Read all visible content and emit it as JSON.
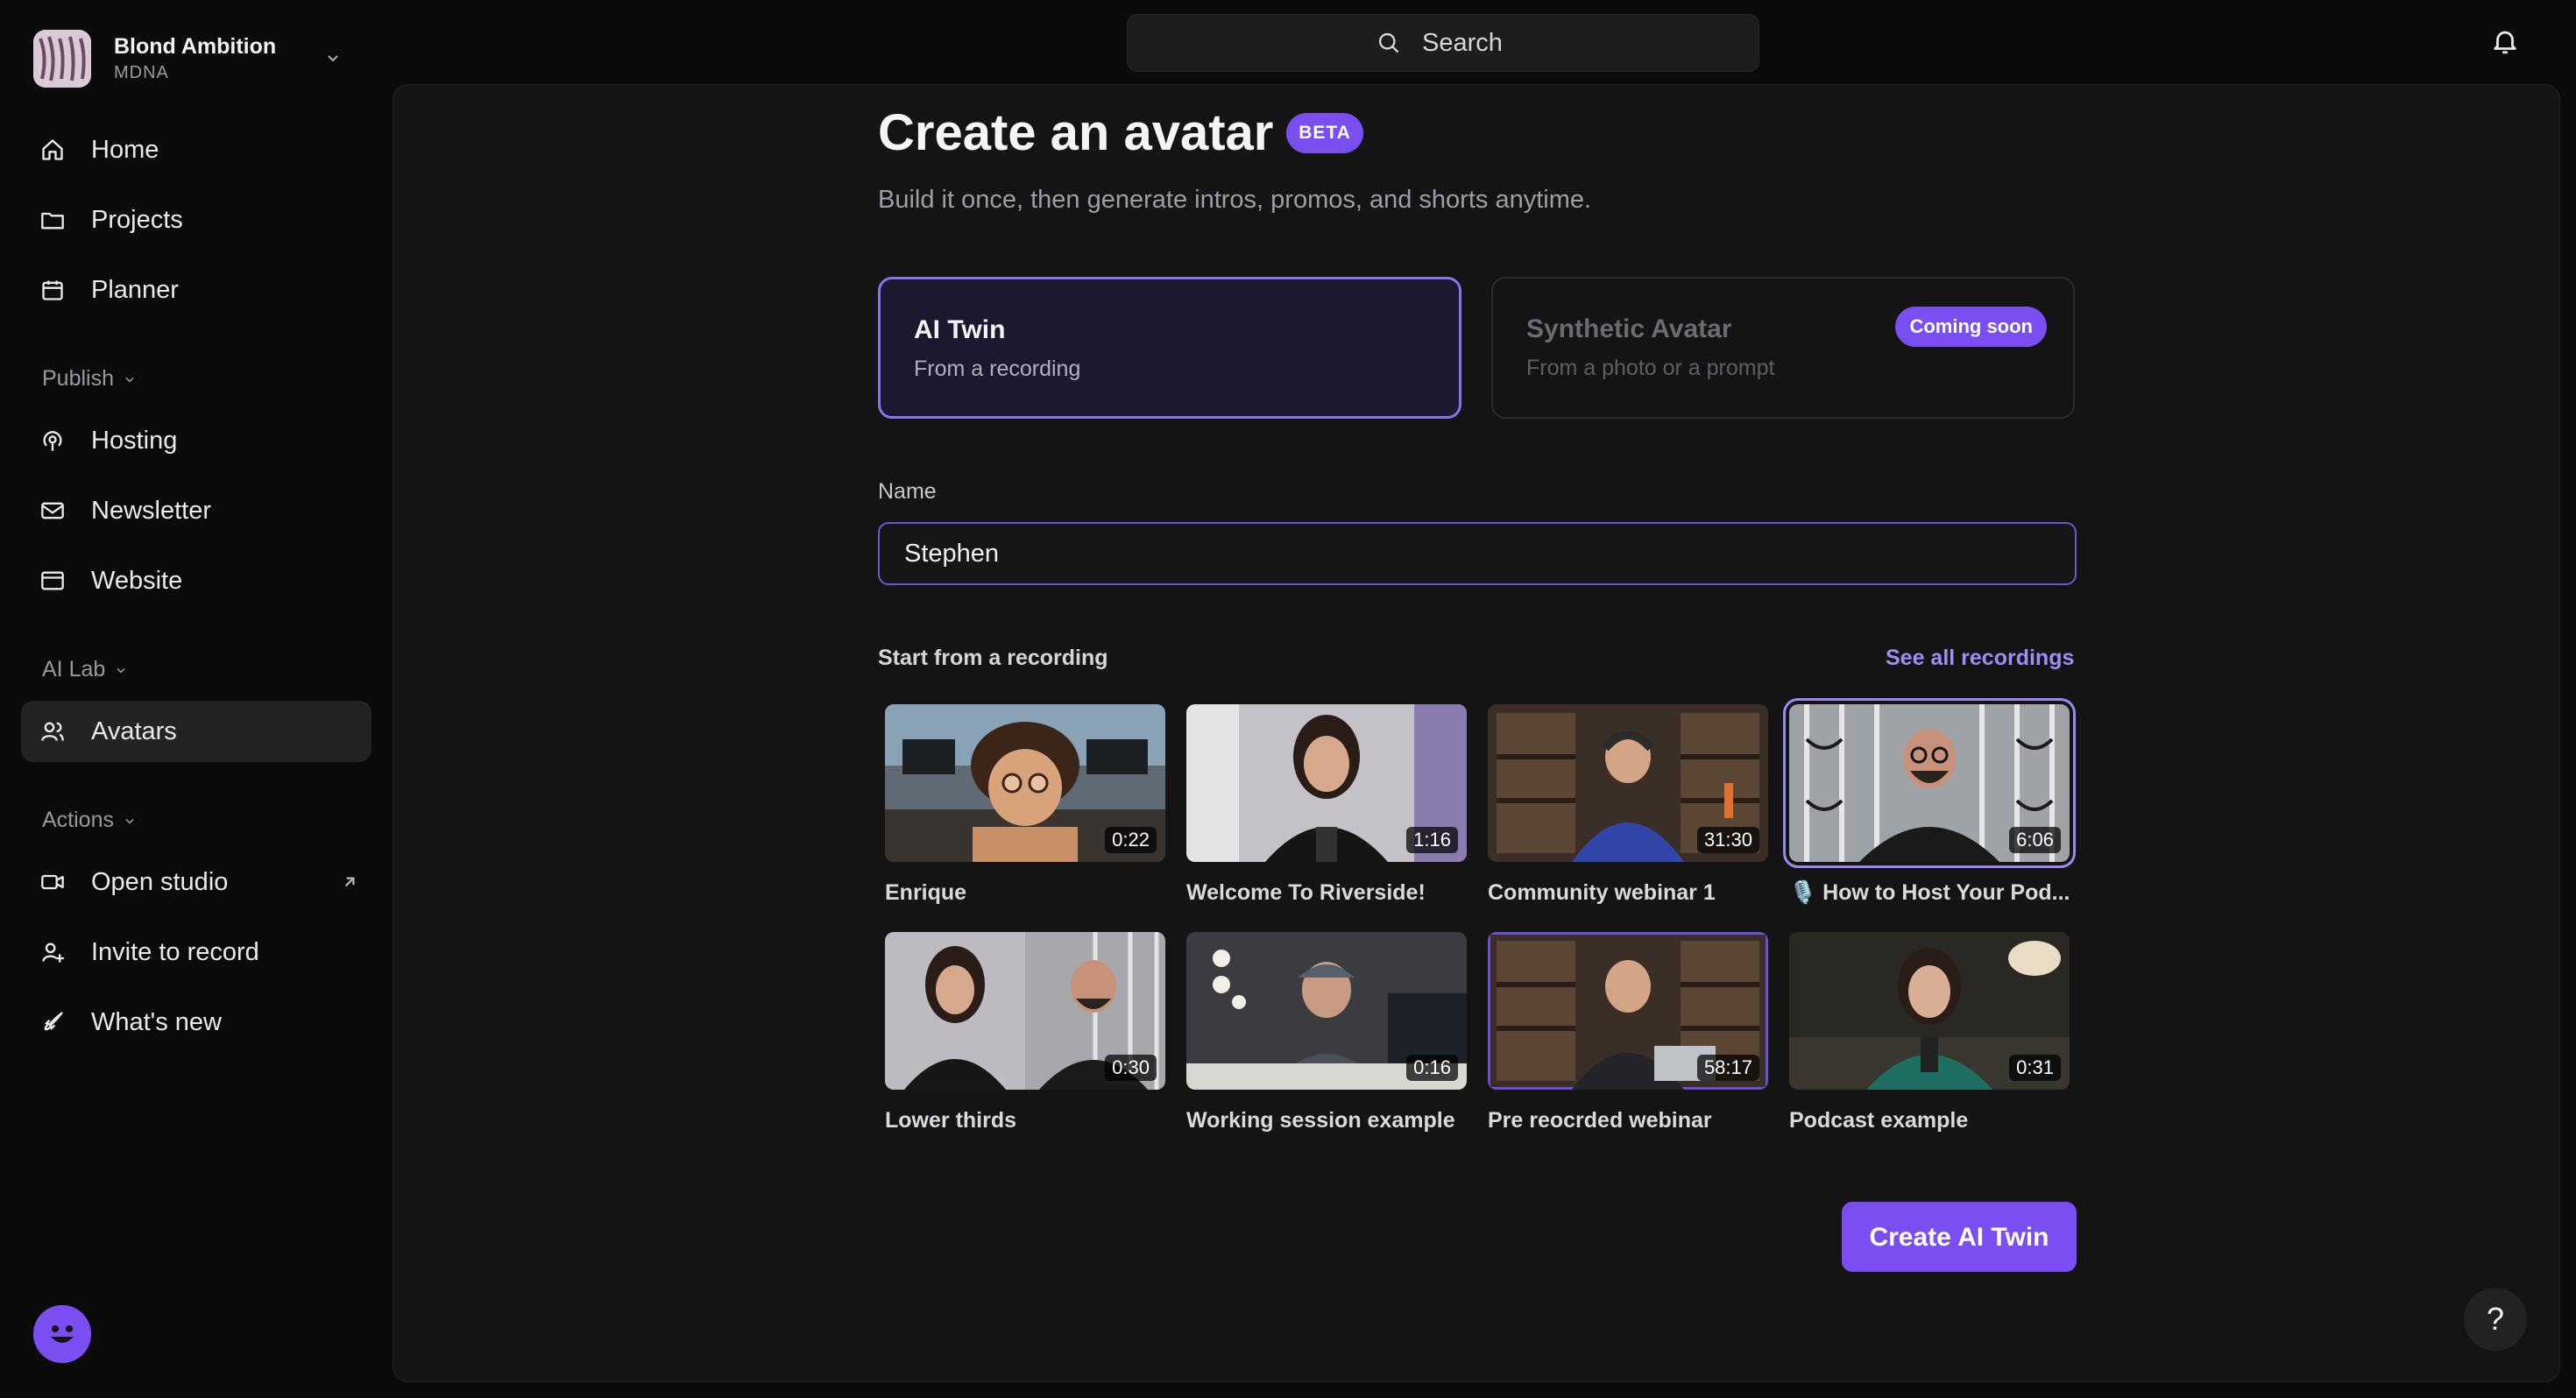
{
  "workspace": {
    "name": "Blond Ambition",
    "sub": "MDNA"
  },
  "nav": {
    "home": "Home",
    "projects": "Projects",
    "planner": "Planner",
    "publish_section": "Publish",
    "hosting": "Hosting",
    "newsletter": "Newsletter",
    "website": "Website",
    "ailab_section": "AI Lab",
    "avatars": "Avatars",
    "actions_section": "Actions",
    "open_studio": "Open studio",
    "invite": "Invite to record",
    "whats_new": "What's new"
  },
  "search": {
    "label": "Search"
  },
  "page": {
    "title": "Create an avatar",
    "badge": "BETA",
    "subtitle": "Build it once, then generate intros, promos, and shorts anytime."
  },
  "options": {
    "ai_twin": {
      "title": "AI Twin",
      "sub": "From a recording"
    },
    "synthetic": {
      "title": "Synthetic Avatar",
      "sub": "From a photo or a prompt",
      "badge": "Coming soon"
    }
  },
  "form": {
    "name_label": "Name",
    "name_value": "Stephen"
  },
  "recordings": {
    "label": "Start from a recording",
    "see_all": "See all recordings",
    "items": [
      {
        "title": "Enrique",
        "duration": "0:22"
      },
      {
        "title": "Welcome To Riverside!",
        "duration": "1:16"
      },
      {
        "title": "Community webinar 1",
        "duration": "31:30"
      },
      {
        "title": "🎙️ How to Host Your Pod...",
        "duration": "6:06"
      },
      {
        "title": "Lower thirds",
        "duration": "0:30"
      },
      {
        "title": "Working session example",
        "duration": "0:16"
      },
      {
        "title": "Pre reocrded webinar",
        "duration": "58:17"
      },
      {
        "title": "Podcast example",
        "duration": "0:31"
      }
    ]
  },
  "cta": {
    "label": "Create AI Twin"
  },
  "help": {
    "label": "?"
  },
  "colors": {
    "accent": "#7a4ef0",
    "link": "#a08cf5",
    "background": "#0b0b0c",
    "panel": "#141415"
  }
}
